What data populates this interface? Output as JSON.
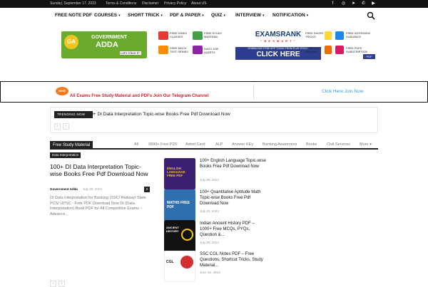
{
  "topbar": {
    "date": "Sunday, September 17, 2023",
    "links": [
      "Terms & Conditions",
      "Disclaimer",
      "Privacy Policy",
      "About US"
    ]
  },
  "nav": {
    "items": [
      {
        "label": "FREE NOTE PDF",
        "dropdown": false
      },
      {
        "label": "COURSES",
        "dropdown": true
      },
      {
        "label": "SHORT TRICK",
        "dropdown": true
      },
      {
        "label": "PDF & PAPER",
        "dropdown": true
      },
      {
        "label": "QUIZ",
        "dropdown": true
      },
      {
        "label": "INTERVIEW",
        "dropdown": true
      },
      {
        "label": "NOTIFICATION",
        "dropdown": true
      }
    ],
    "caret": "▾"
  },
  "banner": {
    "logo_line1": "GOVERNMENT",
    "logo_line2": "ADDA",
    "logo_badge": "GA",
    "logo_tagline": "Let's Clear It !",
    "promo_left": [
      {
        "label": "FREE VIDEO CLASSES",
        "color": "#e53935"
      },
      {
        "label": "FREE STUDY MATERIAL",
        "color": "#43a047"
      },
      {
        "label": "FREE MOCK TEST SERIES",
        "color": "#fb8c00"
      },
      {
        "label": "DAILY JOB ALERTS",
        "color": "#8e24aa"
      }
    ],
    "promo_right": [
      {
        "label": "FREE SHORT TRICKS",
        "color": "#fdd835"
      },
      {
        "label": "FREE INTERVIEW GUIDANCE",
        "color": "#1e88e5"
      },
      {
        "label": "FREE DAILY QUIZZES",
        "color": "#ef6c00"
      },
      {
        "label": "FREE PDFS SUBSCRIPTION",
        "color": "#d81b60"
      }
    ],
    "examsrank": "EXAMSRANK",
    "examsrank_tag": "\" B E  S M A R T \"",
    "click_sub": "DOWNLOAD FREE APP TODAY FROM PLAY STORE",
    "click_main": "CLICK HERE",
    "pdf_badge": "PDF"
  },
  "telegram": {
    "new_tag": "NEW",
    "message": "All Exams Free Study Material and PDFs Join Our Telegram Channel",
    "join": "Click Here Join Now"
  },
  "trending": {
    "tag": "TRENDING NOW",
    "title": "100+ DI Data Interpretation Topic-wise Books Free Pdf Download Now",
    "prev": "‹",
    "next": "›"
  },
  "section": {
    "label": "Free Study Material",
    "filters": [
      "All",
      "9999+ Free PDF",
      "Admit Card",
      "ALP",
      "Answer KEy",
      "Banking Awareness",
      "Books",
      "Civil Services",
      "More"
    ],
    "more_caret": "▾"
  },
  "main_post": {
    "category": "Data Interpretation",
    "title": "100+ DI Data Interpretation Topic-wise Books Free Pdf Download Now",
    "author": "Government Adda",
    "date": "July 25, 2023",
    "comments": "0",
    "excerpt": "DI Data Interpretation for Banking (SSC/ Railway/ State PCS/ UPSC - Free PDF Download Now DI (Data Interpretation) Book PDF for All Competitive Exams :- Advance..."
  },
  "side_posts": [
    {
      "title": "100+ English Language Topic-wise Books Free Pdf Download Now",
      "date": "July 25, 2023",
      "thumb_text": "ENGLISH LANGUAGE FREE PDF",
      "thumb_color": "#3c1f6e",
      "accent": "#f5c518"
    },
    {
      "title": "100+ Quantitative Aptitude Math Topic-wise Books Free Pdf Download Now",
      "date": "July 25, 2023",
      "thumb_text": "MATHS FREE PDF",
      "thumb_color": "#2f6fb0",
      "accent": "#ffffff"
    },
    {
      "title": "Indian Ancient History PDF – 1000+ Free MCQs, PYQs, Question &...",
      "date": "July 25, 2023",
      "thumb_text": "ANCIENT HISTORY",
      "thumb_color": "#111111",
      "accent": "#f5c518"
    },
    {
      "title": "SSC CGL Notes PDF – Free Questions, Shortcut Tricks, Study Material...",
      "date": "June 25, 2023",
      "thumb_text": "CGL",
      "thumb_color": "#ffffff",
      "accent": "#d32f2f"
    }
  ],
  "pager": {
    "prev": "‹",
    "next": "›"
  },
  "icons": [
    "facebook-icon",
    "instagram-icon",
    "telegram-icon",
    "whatsapp-icon",
    "youtube-icon",
    "search-icon"
  ]
}
